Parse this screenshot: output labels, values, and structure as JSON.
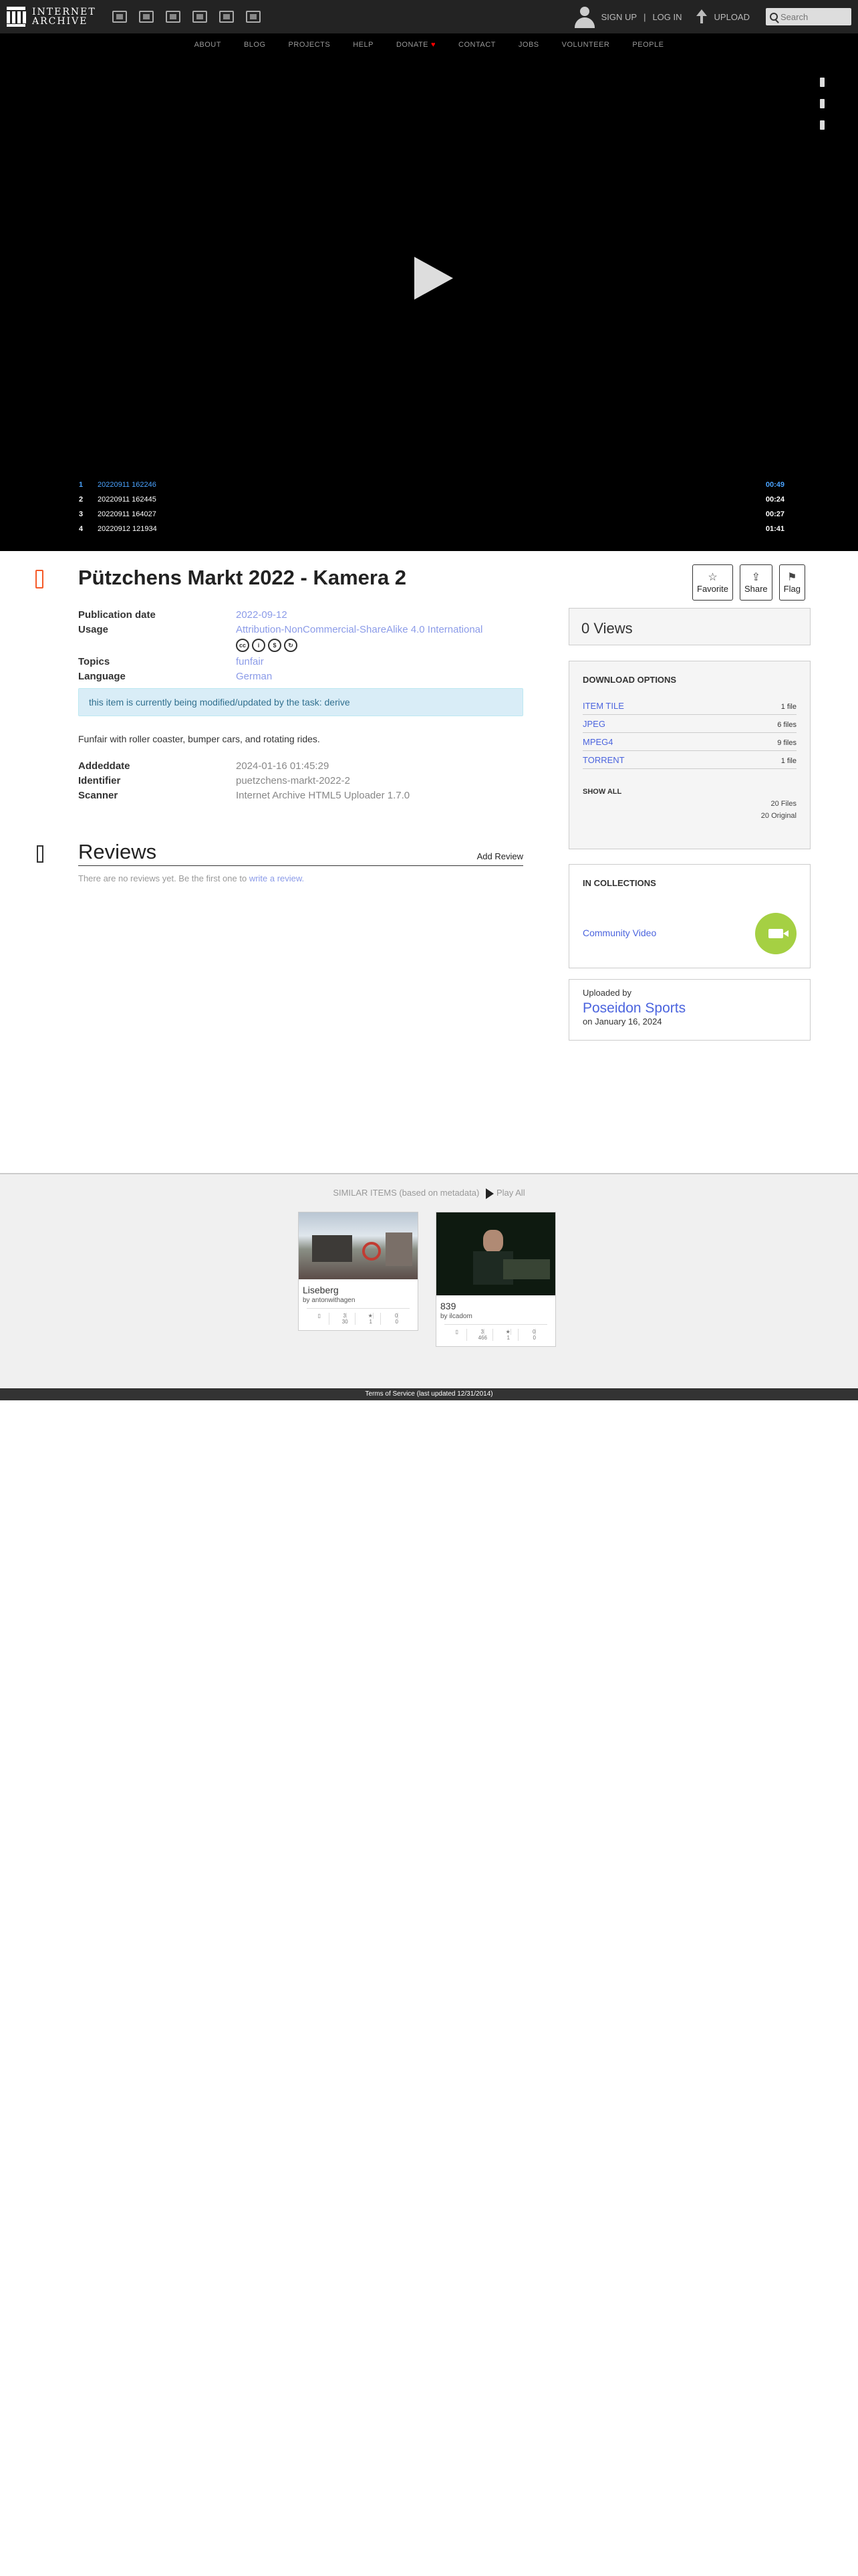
{
  "nav": {
    "logo_line1": "INTERNET",
    "logo_line2": "ARCHIVE",
    "signup": "SIGN UP",
    "sep": "|",
    "login": "LOG IN",
    "upload": "UPLOAD",
    "search_placeholder": "Search"
  },
  "subnav": [
    "ABOUT",
    "BLOG",
    "PROJECTS",
    "HELP",
    "DONATE",
    "CONTACT",
    "JOBS",
    "VOLUNTEER",
    "PEOPLE"
  ],
  "playlist": [
    {
      "num": "1",
      "name": "20220911 162246",
      "dur": "00:49"
    },
    {
      "num": "2",
      "name": "20220911 162445",
      "dur": "00:24"
    },
    {
      "num": "3",
      "name": "20220911 164027",
      "dur": "00:27"
    },
    {
      "num": "4",
      "name": "20220912 121934",
      "dur": "01:41"
    }
  ],
  "item": {
    "title": "Pützchens Markt 2022 - Kamera 2",
    "favorite": "Favorite",
    "share": "Share",
    "flag": "Flag",
    "pubdate_label": "Publication date",
    "pubdate": "2022-09-12",
    "usage_label": "Usage",
    "usage": "Attribution-NonCommercial-ShareAlike 4.0 International",
    "topics_label": "Topics",
    "topics": "funfair",
    "language_label": "Language",
    "language": "German",
    "notice": "this item is currently being modified/updated by the task: derive",
    "description": "Funfair with roller coaster, bumper cars, and rotating rides.",
    "addeddate_label": "Addeddate",
    "addeddate": "2024-01-16 01:45:29",
    "identifier_label": "Identifier",
    "identifier": "puetzchens-markt-2022-2",
    "scanner_label": "Scanner",
    "scanner": "Internet Archive HTML5 Uploader 1.7.0"
  },
  "reviews": {
    "title": "Reviews",
    "add": "Add Review",
    "empty": "There are no reviews yet. Be the first one to",
    "write": "write a review."
  },
  "sidebar": {
    "views": "0 Views",
    "download_title": "DOWNLOAD OPTIONS",
    "downloads": [
      {
        "label": "ITEM TILE",
        "count": "1 file"
      },
      {
        "label": "JPEG",
        "count": "6 files"
      },
      {
        "label": "MPEG4",
        "count": "9 files"
      },
      {
        "label": "TORRENT",
        "count": "1 file"
      }
    ],
    "show_all": "SHOW ALL",
    "total_files": "20 Files",
    "total_original": "20 Original",
    "collections_title": "IN COLLECTIONS",
    "collection": "Community Video",
    "uploaded_by_label": "Uploaded by",
    "uploader": "Poseidon Sports",
    "upload_date": "on January 16, 2024"
  },
  "similar": {
    "heading": "SIMILAR ITEMS (based on metadata)",
    "play_all": "Play All",
    "tiles": [
      {
        "title": "Liseberg",
        "by": "by antonwithagen",
        "s1": "3",
        "s1b": "30",
        "s2": "1",
        "s3": "0",
        "s3b": "0"
      },
      {
        "title": "839",
        "by": "by ilcadom",
        "s1": "3",
        "s1b": "466",
        "s2": "1",
        "s3": "0",
        "s3b": "0"
      }
    ]
  },
  "footer": "Terms of Service (last updated 12/31/2014)"
}
